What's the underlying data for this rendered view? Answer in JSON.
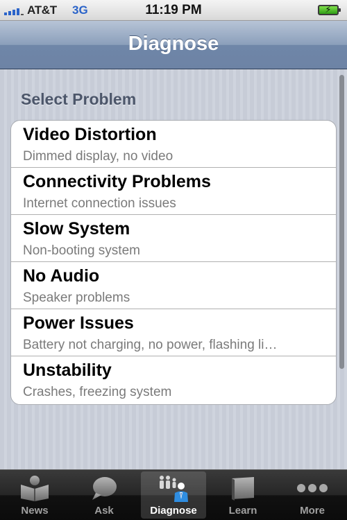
{
  "status_bar": {
    "carrier": "AT&T",
    "network": "3G",
    "time": "11:19 PM"
  },
  "nav_bar": {
    "title": "Diagnose"
  },
  "section": {
    "header": "Select Problem"
  },
  "problems": [
    {
      "title": "Video Distortion",
      "subtitle": "Dimmed display, no video"
    },
    {
      "title": "Connectivity Problems",
      "subtitle": "Internet connection issues"
    },
    {
      "title": "Slow System",
      "subtitle": "Non-booting system"
    },
    {
      "title": "No Audio",
      "subtitle": "Speaker problems"
    },
    {
      "title": "Power Issues",
      "subtitle": "Battery not charging, no power, flashing li…"
    },
    {
      "title": "Unstability",
      "subtitle": "Crashes, freezing system"
    }
  ],
  "tab_bar": {
    "tabs": [
      {
        "label": "News",
        "icon": "news-icon"
      },
      {
        "label": "Ask",
        "icon": "chat-bubble-icon"
      },
      {
        "label": "Diagnose",
        "icon": "people-icon",
        "selected": true
      },
      {
        "label": "Learn",
        "icon": "book-icon"
      },
      {
        "label": "More",
        "icon": "more-dots-icon"
      }
    ]
  },
  "colors": {
    "nav_bar": "#8b9fbb",
    "tab_active_label": "#ffffff",
    "tab_inactive_label": "#a0a0a0",
    "accent_blue": "#2a63c9",
    "battery_green": "#4cc72a"
  }
}
